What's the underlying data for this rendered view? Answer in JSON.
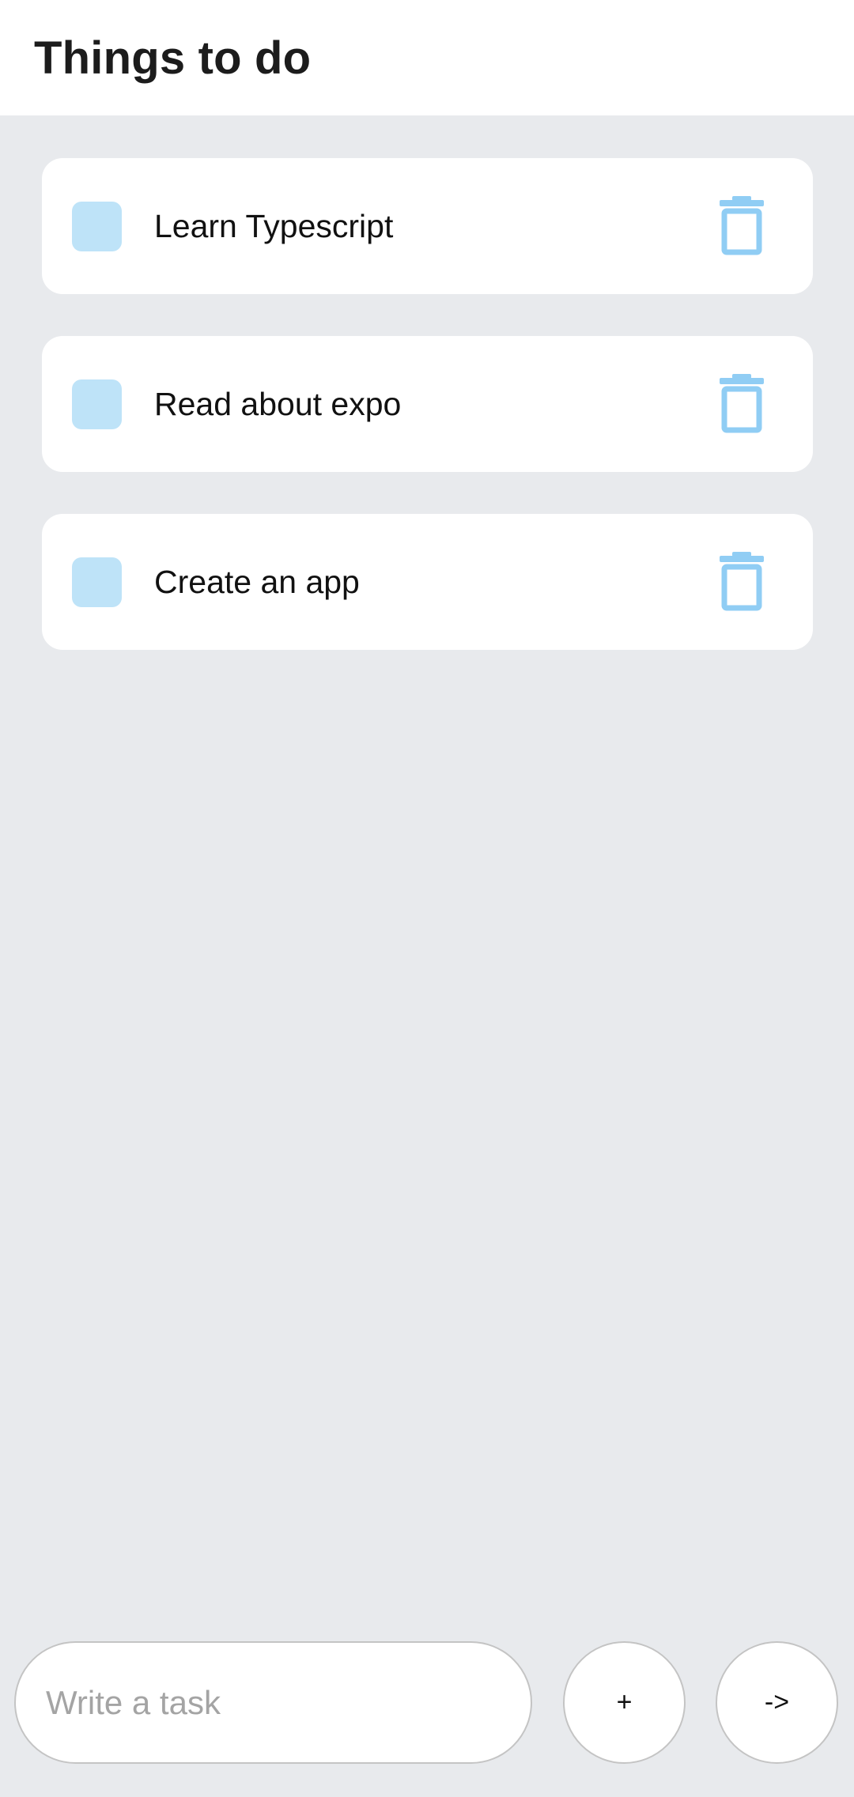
{
  "header": {
    "title": "Things to do"
  },
  "tasks": [
    {
      "label": "Learn Typescript",
      "checked": false
    },
    {
      "label": "Read about expo",
      "checked": false
    },
    {
      "label": "Create an app",
      "checked": false
    }
  ],
  "input": {
    "placeholder": "Write a task",
    "value": ""
  },
  "buttons": {
    "add_label": "+",
    "next_label": "->"
  },
  "icons": {
    "delete": "trash-icon"
  },
  "colors": {
    "background": "#e8eaed",
    "card": "#ffffff",
    "checkbox": "#bee3f8",
    "trash": "#90cdf4",
    "border": "#c4c4c4"
  }
}
